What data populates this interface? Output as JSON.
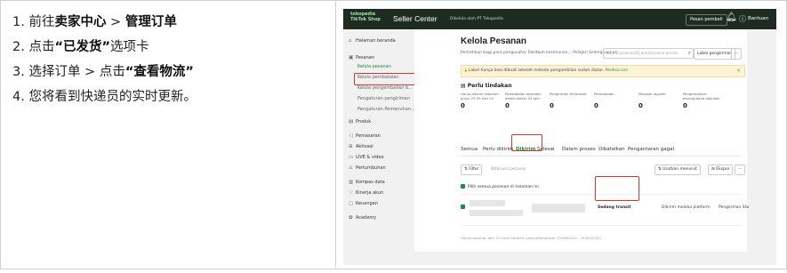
{
  "steps": [
    {
      "num": "1.",
      "parts": [
        {
          "t": "前往",
          "b": false
        },
        {
          "t": "卖家中心",
          "b": true
        },
        {
          "t": " > ",
          "b": false
        },
        {
          "t": "管理订单",
          "b": true
        }
      ]
    },
    {
      "num": "2.",
      "parts": [
        {
          "t": "点击",
          "b": false
        },
        {
          "t": "“已发货”",
          "b": true
        },
        {
          "t": "选项卡",
          "b": false
        }
      ]
    },
    {
      "num": "3.",
      "parts": [
        {
          "t": "选择订单 > 点击",
          "b": false
        },
        {
          "t": "“查看物流”",
          "b": true
        }
      ]
    },
    {
      "num": "4.",
      "parts": [
        {
          "t": "您将看到快递员的实时更新。",
          "b": false
        }
      ]
    }
  ],
  "app": {
    "logo_line1": "tokopedia",
    "logo_line2": "TikTok Shop",
    "brand": "Seller Center",
    "brand_sub": "Dikelola oleh PT Tokopedia",
    "btn_pesan": "Pesan pembeli",
    "bell_icon": "bell-icon",
    "bantuan": "Bantuan"
  },
  "sidebar": [
    {
      "label": "Halaman beranda",
      "icon": "⌂",
      "sub": false,
      "hl": false
    },
    {
      "label": "Pesanan",
      "icon": "▣",
      "sub": false,
      "hl": false
    },
    {
      "label": "Kelola pesanan",
      "icon": "",
      "sub": true,
      "hl": true
    },
    {
      "label": "Kelola pembatalan",
      "icon": "",
      "sub": true,
      "hl": false
    },
    {
      "label": "Kelola pengembalian b...",
      "icon": "",
      "sub": true,
      "hl": false
    },
    {
      "label": "Pengaturan pengiriman",
      "icon": "",
      "sub": true,
      "hl": false
    },
    {
      "label": "Pengaturan Pemenuhan...",
      "icon": "",
      "sub": true,
      "hl": false
    },
    {
      "label": "Produk",
      "icon": "▤",
      "sub": false,
      "hl": false
    },
    {
      "label": "Pemasaran",
      "icon": "◁",
      "sub": false,
      "hl": false
    },
    {
      "label": "Aktivasi",
      "icon": "⊞",
      "sub": false,
      "hl": false
    },
    {
      "label": "LIVE & video",
      "icon": "▭",
      "sub": false,
      "hl": false
    },
    {
      "label": "Pertumbuhan",
      "icon": "♙",
      "sub": false,
      "hl": false
    },
    {
      "label": "Kompas data",
      "icon": "▥",
      "sub": false,
      "hl": false
    },
    {
      "label": "Kinerja akun",
      "icon": "♡",
      "sub": false,
      "hl": false
    },
    {
      "label": "Keuangan",
      "icon": "▢",
      "sub": false,
      "hl": false
    },
    {
      "label": "Academy",
      "icon": "✿",
      "sub": false,
      "hl": false
    }
  ],
  "main": {
    "title": "Kelola Pesanan",
    "subtitle": "Perhatikan bagi para pengusaha: Pasitkan kesimanan... Pelajari Selengkapnya",
    "search_placeholder": "Cari ID pesanan/ID produk/nama produk",
    "btn_label": "Label pengiriman",
    "btn_more": "···",
    "banner_text": "Label hanya bisa dibuat setelah metode pengambilan sudah diatur.",
    "banner_link": "Periksa sini",
    "todo_title": "Perlu tindakan",
    "todo": [
      {
        "label": "Harus dikirim sebelum pukul 23:59 hari ini",
        "value": "0"
      },
      {
        "label": "Pembatalan otomatis dalam waktu 24 jam",
        "value": "0"
      },
      {
        "label": "Pengiriman terlambat",
        "value": "0"
      },
      {
        "label": "Pembatalan",
        "value": "0"
      },
      {
        "label": "Masalah logistik",
        "value": "0"
      },
      {
        "label": "Pengembalian barang/dana diajukan",
        "value": "0"
      }
    ],
    "tabs": [
      "Semua",
      "Perlu dikirim",
      "Dikirim",
      "Selesai",
      "Dalam proses",
      "Dibatalkan",
      "Pengantaran gagal"
    ],
    "filter": "Filter",
    "filter_placeholder": "Kata kunci pesanan",
    "sort": "Urutkan menurut",
    "export": "Ekspor",
    "select_text": "Pilih semua pesanan di halaman ini",
    "status": "Sedang transit",
    "ship": "Dikirim melalui platform",
    "ship2": "Pengiriman Sta",
    "footer": "Hanya pesanan dari 12 bulan terakhir yang ditampilkan (15/09/2024 - 15/09/2025)"
  }
}
